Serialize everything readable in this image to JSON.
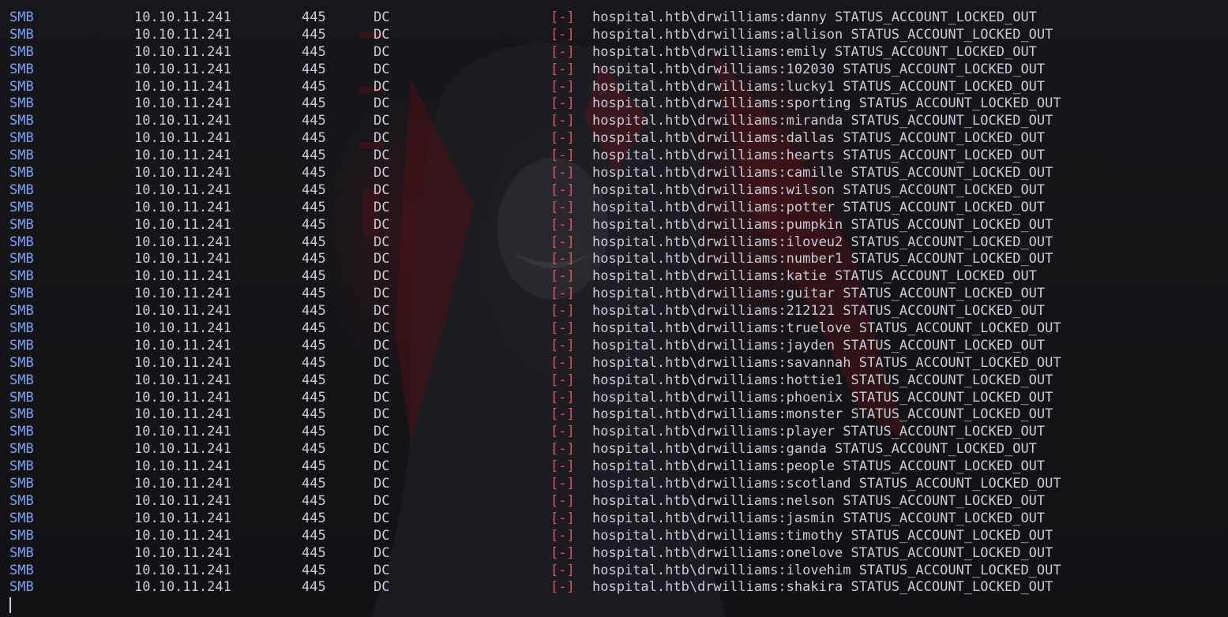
{
  "terminal": {
    "columns": {
      "proto": "SMB",
      "ip": "10.10.11.241",
      "port": "445",
      "host": "DC",
      "status": "[-]"
    },
    "prefix": "hospital.htb\\drwilliams:",
    "result": "STATUS_ACCOUNT_LOCKED_OUT",
    "passwords": [
      "danny",
      "allison",
      "emily",
      "102030",
      "lucky1",
      "sporting",
      "miranda",
      "dallas",
      "hearts",
      "camille",
      "wilson",
      "potter",
      "pumpkin",
      "iloveu2",
      "number1",
      "katie",
      "guitar",
      "212121",
      "truelove",
      "jayden",
      "savannah",
      "hottie1",
      "phoenix",
      "monster",
      "player",
      "ganda",
      "people",
      "scotland",
      "nelson",
      "jasmin",
      "timothy",
      "onelove",
      "ilovehim",
      "shakira"
    ],
    "colors": {
      "proto": "#7aa2f7",
      "text": "#c9ccd8",
      "status_fail": "#e05561",
      "background": "#141418"
    }
  }
}
